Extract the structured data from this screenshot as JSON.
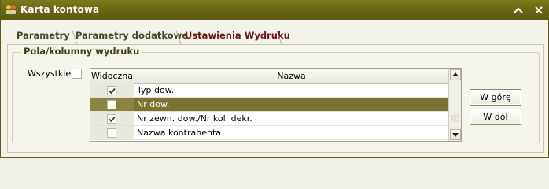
{
  "window": {
    "title": "Karta kontowa",
    "accent_color": "#6b6814"
  },
  "tabs": [
    {
      "label": "Parametry",
      "active": false
    },
    {
      "label": "Parametry dodatkowe",
      "active": false
    },
    {
      "label": "Ustawienia Wydruku",
      "active": true
    }
  ],
  "group": {
    "title": "Pola/kolumny wydruku",
    "select_all_label": "Wszystkie",
    "select_all_checked": false
  },
  "grid": {
    "columns": [
      "Widoczna",
      "Nazwa"
    ],
    "rows": [
      {
        "visible": true,
        "name": "Typ dow."
      },
      {
        "visible": false,
        "name": "Nr dow."
      },
      {
        "visible": true,
        "name": "Nr zewn. dow./Nr kol. dekr."
      },
      {
        "visible": false,
        "name": "Nazwa kontrahenta"
      }
    ],
    "selected_row": 1,
    "selection_color": "#7a7230"
  },
  "buttons": {
    "up": "W górę",
    "down": "W dół"
  }
}
